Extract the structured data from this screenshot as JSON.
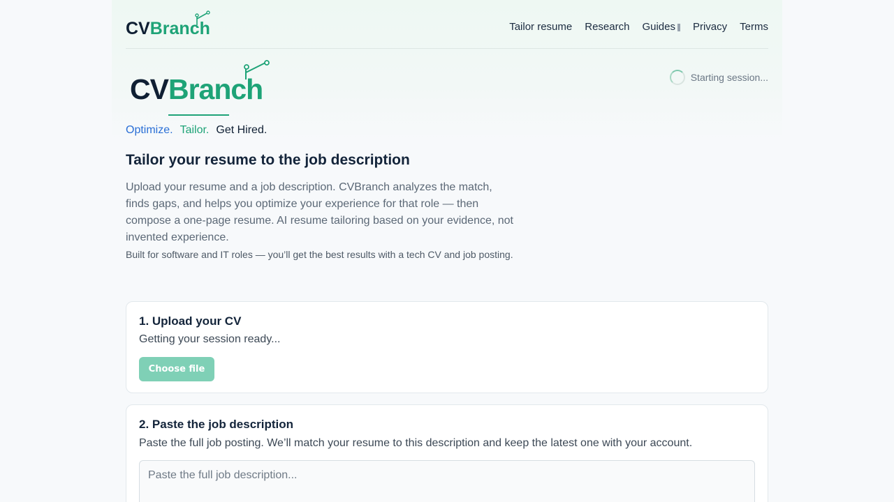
{
  "brand": {
    "name_cv": "CV",
    "name_branch": "Branch",
    "colors": {
      "navy": "#0f1f33",
      "green": "#1ea377",
      "blue": "#2a6fd6"
    }
  },
  "nav": {
    "items": [
      {
        "label": "Tailor resume"
      },
      {
        "label": "Research"
      },
      {
        "label": "Guides"
      },
      {
        "label": "Privacy"
      },
      {
        "label": "Terms"
      }
    ]
  },
  "tagline": {
    "part1": "Optimize.",
    "part2": "Tailor.",
    "part3": "Get Hired."
  },
  "status": {
    "text": "Starting session..."
  },
  "intro": {
    "headline": "Tailor your resume to the job description",
    "description": "Upload your resume and a job description. CVBranch analyzes the match, finds gaps, and helps you optimize your experience for that role — then compose a one-page resume. AI resume tailoring based on your evidence, not invented experience.",
    "note": "Built for software and IT roles — you’ll get the best results with a tech CV and job posting."
  },
  "upload_card": {
    "title": "1. Upload your CV",
    "status": "Getting your session ready...",
    "button_label": "Choose file"
  },
  "job_card": {
    "title": "2. Paste the job description",
    "description": "Paste the full job posting. We’ll match your resume to this description and keep the latest one with your account.",
    "placeholder": "Paste the full job description..."
  }
}
